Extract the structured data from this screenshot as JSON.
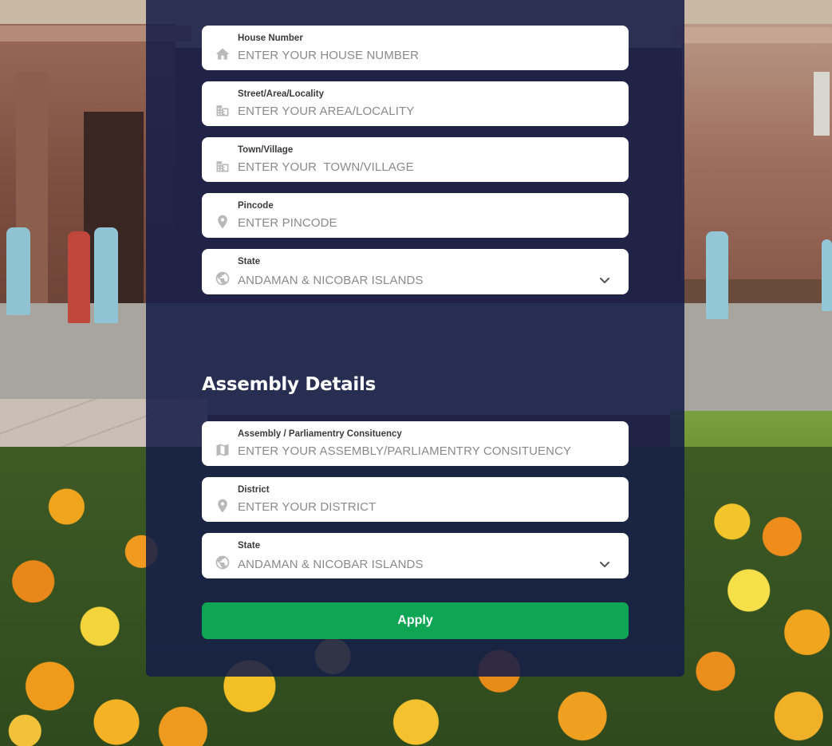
{
  "address": {
    "house_number": {
      "label": "House Number",
      "placeholder": "ENTER YOUR HOUSE NUMBER",
      "icon": "home-icon"
    },
    "street": {
      "label": "Street/Area/Locality",
      "placeholder": "ENTER YOUR AREA/LOCALITY",
      "icon": "building-icon"
    },
    "town": {
      "label": "Town/Village",
      "placeholder": "ENTER YOUR  TOWN/VILLAGE",
      "icon": "building-icon"
    },
    "pincode": {
      "label": "Pincode",
      "placeholder": "ENTER PINCODE",
      "icon": "location-pin-icon"
    },
    "state": {
      "label": "State",
      "value": "ANDAMAN & NICOBAR ISLANDS",
      "icon": "globe-icon"
    }
  },
  "assembly": {
    "title": "Assembly Details",
    "constituency": {
      "label": "Assembly / Parliamentry Consituency",
      "placeholder": "ENTER YOUR ASSEMBLY/PARLIAMENTRY CONSITUENCY",
      "icon": "map-icon"
    },
    "district": {
      "label": "District",
      "placeholder": "ENTER YOUR DISTRICT",
      "icon": "location-pin-icon"
    },
    "state": {
      "label": "State",
      "value": "ANDAMAN & NICOBAR ISLANDS",
      "icon": "globe-icon"
    }
  },
  "apply_label": "Apply",
  "colors": {
    "panel": "#161e48",
    "button": "#0ea654",
    "icon": "#b9b9b9"
  }
}
